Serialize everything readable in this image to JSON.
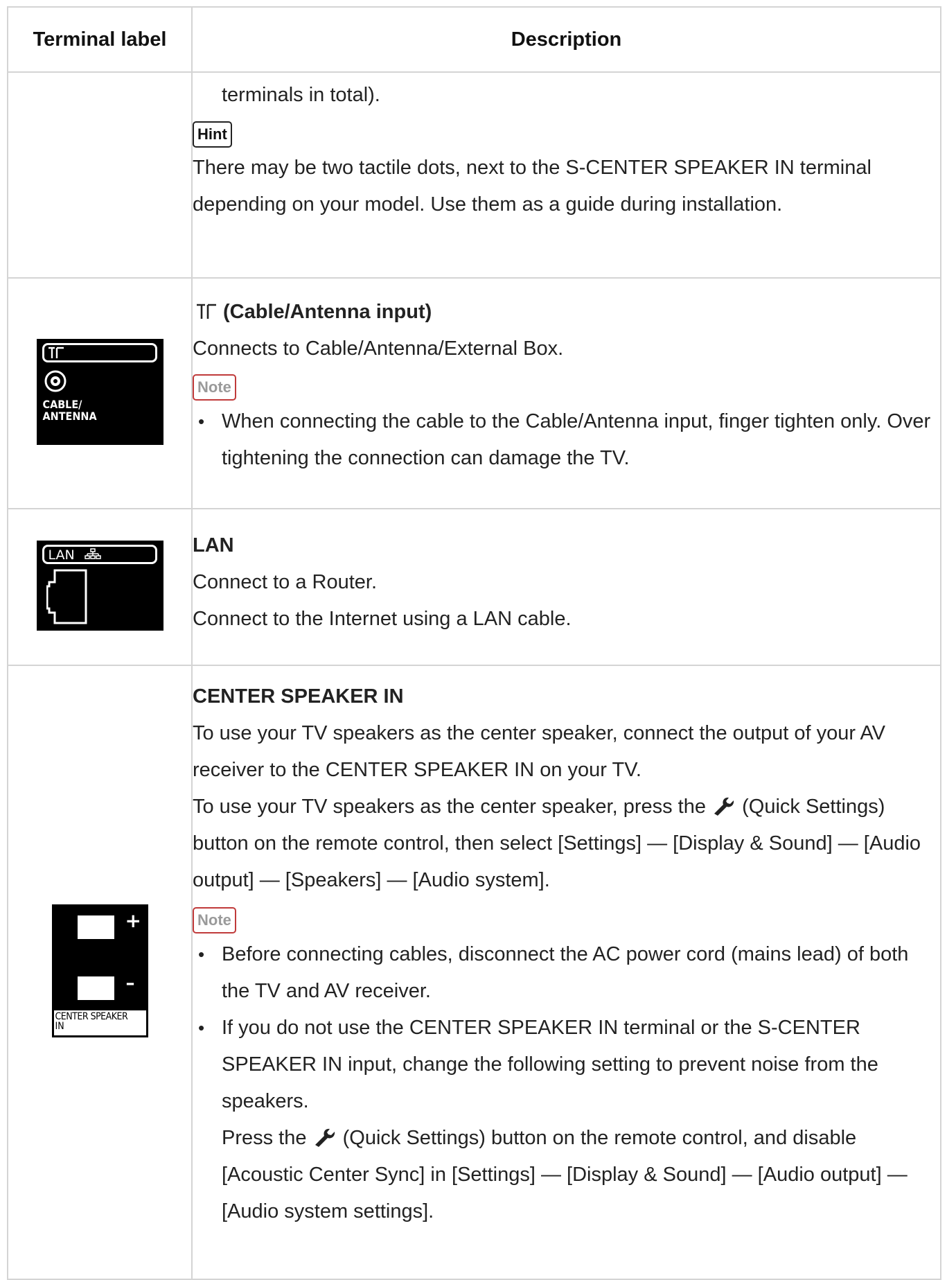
{
  "header": {
    "col1": "Terminal label",
    "col2": "Description"
  },
  "rows": {
    "row1": {
      "continuation": "terminals in total).",
      "hint_label": "Hint",
      "hint_text": "There may be two tactile dots, next to the S-CENTER SPEAKER IN terminal depending on your model. Use them as a guide during installation."
    },
    "row2": {
      "image_text_top": "CABLE/",
      "image_text_bottom": "ANTENNA",
      "symbol": "⊤⊤",
      "title": "(Cable/Antenna input)",
      "line1": "Connects to Cable/Antenna/External Box.",
      "note_label": "Note",
      "bullet1": "When connecting the cable to the Cable/Antenna input, finger tighten only. Over tightening the connection can damage the TV."
    },
    "row3": {
      "image_text": "LAN",
      "title": "LAN",
      "line1": "Connect to a Router.",
      "line2": "Connect to the Internet using a LAN cable."
    },
    "row4": {
      "image_plus": "+",
      "image_minus": "–",
      "image_text_top": "CENTER SPEAKER",
      "image_text_bottom": "IN",
      "title": "CENTER SPEAKER IN",
      "para1": "To use your TV speakers as the center speaker, connect the output of your AV receiver to the CENTER SPEAKER IN on your TV.",
      "para2_pre": "To use your TV speakers as the center speaker, press the",
      "para2_post": "(Quick Settings) button on the remote control, then select [Settings] — [Display & Sound] — [Audio output] — [Speakers] — [Audio system].",
      "note_label": "Note",
      "bullet1": "Before connecting cables, disconnect the AC power cord (mains lead) of both the TV and AV receiver.",
      "bullet2": "If you do not use the CENTER SPEAKER IN terminal or the S-CENTER SPEAKER IN input, change the following setting to prevent noise from the speakers.",
      "bullet2_cont_pre": "Press the",
      "bullet2_cont_post": "(Quick Settings) button on the remote control, and disable [Acoustic Center Sync] in [Settings] — [Display & Sound] — [Audio output] — [Audio system settings]."
    }
  },
  "icons": {
    "antenna": "antenna-icon",
    "wrench": "wrench-icon",
    "lan": "network-icon"
  }
}
